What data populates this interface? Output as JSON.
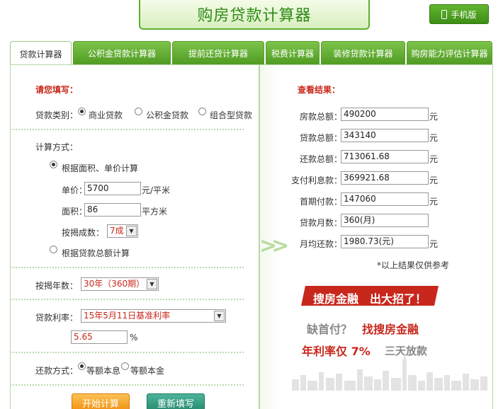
{
  "header": {
    "title": "购房贷款计算器",
    "mobile_label": "手机版"
  },
  "tabs": [
    "贷款计算器",
    "公积金贷款计算器",
    "提前还贷计算器",
    "税费计算器",
    "装修贷款计算器",
    "购房能力评估计算器"
  ],
  "form": {
    "heading": "请您填写：",
    "loan_type_label": "贷款类别：",
    "loan_types": [
      "商业贷款",
      "公积金贷款",
      "组合型贷款"
    ],
    "calc_method_label": "计算方式：",
    "method_area": "根据面积、单价计算",
    "unit_price_label": "单价：",
    "unit_price": "5700",
    "unit_price_unit": "元/平米",
    "area_label": "面积：",
    "area": "86",
    "area_unit": "平方米",
    "ratio_label": "按揭成数：",
    "ratio": "7成",
    "method_total": "根据贷款总额计算",
    "years_label": "按揭年数：",
    "years": "30年（360期）",
    "rate_label": "贷款利率：",
    "rate_option": "15年5月11日基准利率",
    "rate_value": "5.65",
    "rate_unit": "%",
    "repay_label": "还款方式：",
    "repay_options": [
      "等额本息",
      "等额本金"
    ],
    "start_button": "开始计算",
    "reset_button": "重新填写"
  },
  "results": {
    "heading": "查看结果：",
    "rows": [
      {
        "label": "房款总额：",
        "value": "490200",
        "unit": "元"
      },
      {
        "label": "贷款总额：",
        "value": "343140",
        "unit": "元"
      },
      {
        "label": "还款总额：",
        "value": "713061.68",
        "unit": "元"
      },
      {
        "label": "支付利息款：",
        "value": "369921.68",
        "unit": "元"
      },
      {
        "label": "首期付款：",
        "value": "147060",
        "unit": "元"
      },
      {
        "label": "贷款月数：",
        "value": "360(月)",
        "unit": ""
      },
      {
        "label": "月均还款：",
        "value": "1980.73(元)",
        "unit": "元"
      }
    ],
    "note": "*以上结果仅供参考"
  },
  "ad": {
    "slogan": "搜房金融　出大招了！",
    "line1_gray": "缺首付？",
    "line1_red": "找搜房金融",
    "line2_red": "年利率仅 7%",
    "line2_gray": "三天放款"
  }
}
